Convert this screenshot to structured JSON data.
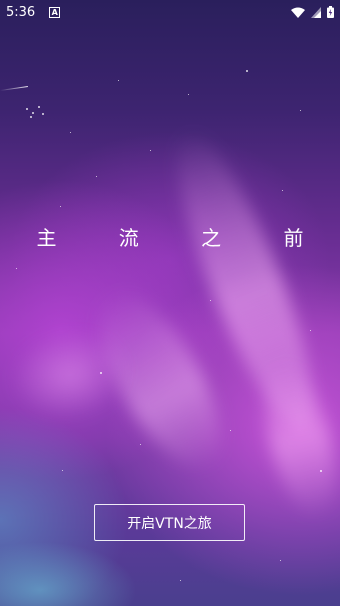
{
  "status_bar": {
    "time": "5:36",
    "notification_badge": "A",
    "icons": [
      "wifi-icon",
      "signal-icon",
      "battery-charging-icon"
    ]
  },
  "splash": {
    "title": "主 流 之 前",
    "start_button_label": "开启VTN之旅"
  },
  "colors": {
    "text": "#ffffff",
    "background_top": "#2a1f5c",
    "background_mid": "#8a3aae",
    "aurora_accent": "#dc5ae6"
  }
}
